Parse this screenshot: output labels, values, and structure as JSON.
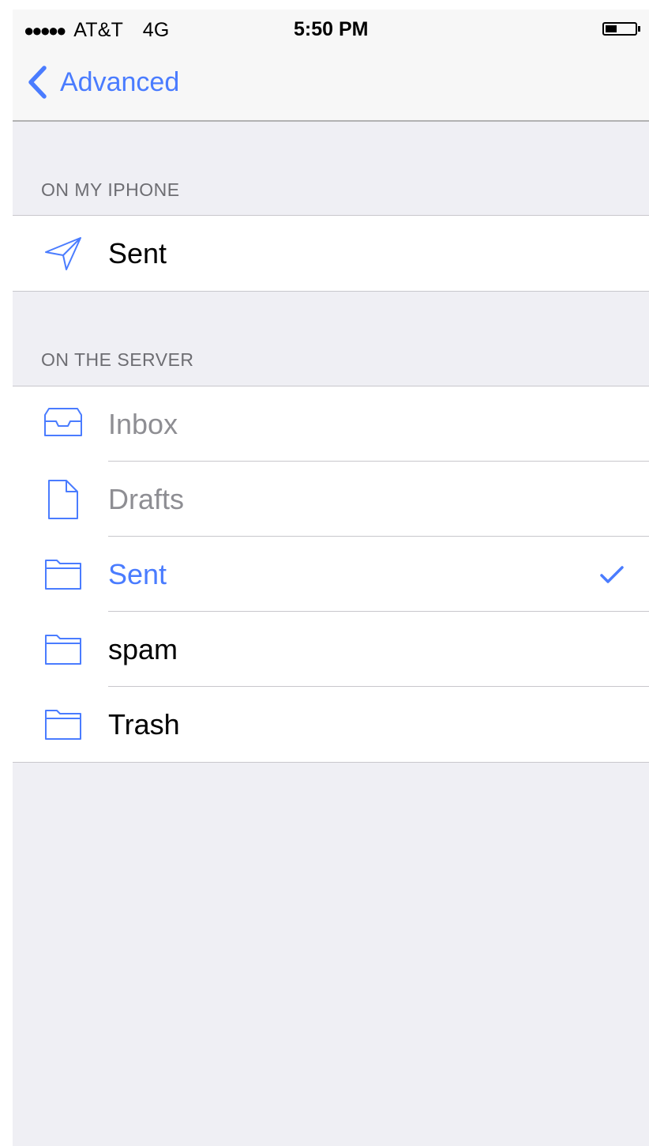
{
  "status_bar": {
    "signal_dots": "●●●●●",
    "carrier": "AT&T",
    "network": "4G",
    "time": "5:50 PM"
  },
  "nav": {
    "back_label": "Advanced"
  },
  "sections": {
    "on_my_iphone": {
      "header": "ON MY IPHONE",
      "items": [
        {
          "label": "Sent",
          "icon": "paper-plane-icon"
        }
      ]
    },
    "on_the_server": {
      "header": "ON THE SERVER",
      "items": [
        {
          "label": "Inbox",
          "icon": "inbox-tray-icon",
          "state": "disabled"
        },
        {
          "label": "Drafts",
          "icon": "document-icon",
          "state": "disabled"
        },
        {
          "label": "Sent",
          "icon": "folder-icon",
          "state": "selected"
        },
        {
          "label": "spam",
          "icon": "folder-icon",
          "state": "normal"
        },
        {
          "label": "Trash",
          "icon": "folder-icon",
          "state": "normal"
        }
      ]
    }
  },
  "colors": {
    "accent": "#4a7cff",
    "background": "#efeff4",
    "disabled_text": "#8e8e93",
    "section_header": "#6d6d72"
  }
}
